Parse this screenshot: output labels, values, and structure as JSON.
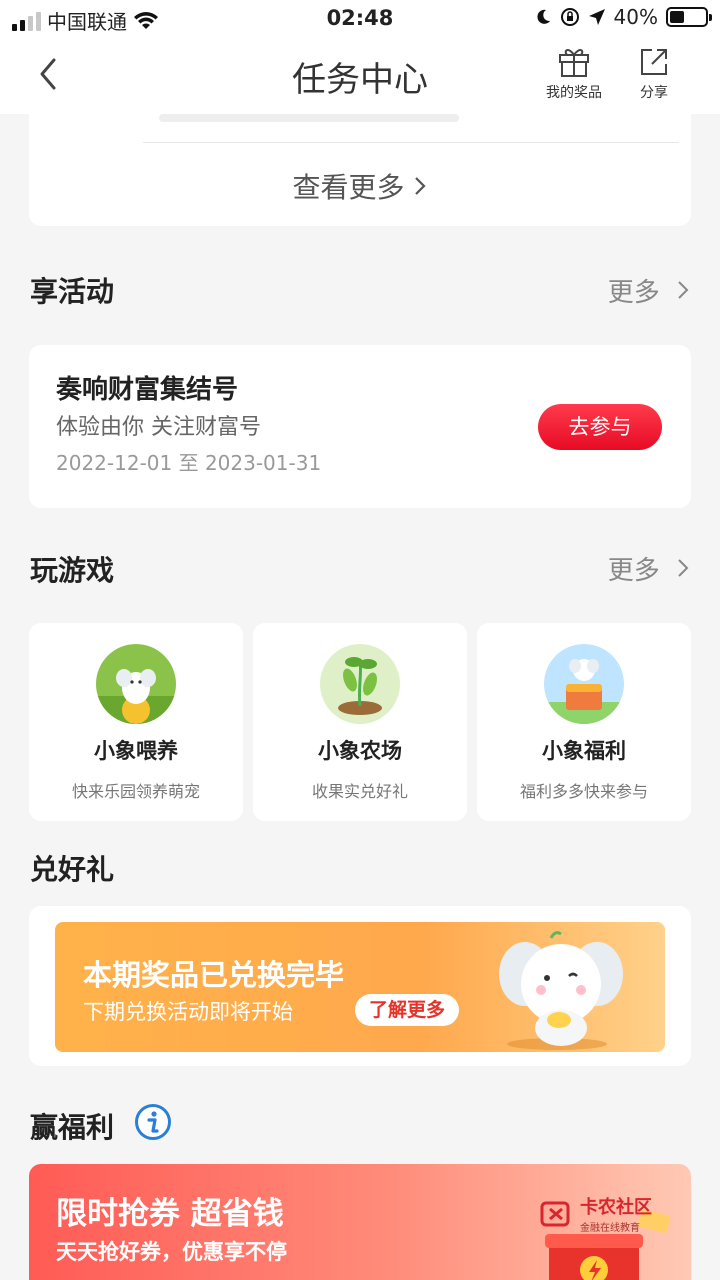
{
  "status_bar": {
    "carrier": "中国联通",
    "time": "02:48",
    "battery": "40%",
    "battery_level": 0.4
  },
  "nav": {
    "title": "任务中心",
    "prizes_label": "我的奖品",
    "share_label": "分享"
  },
  "top_card": {
    "more_label": "查看更多"
  },
  "activities": {
    "title": "享活动",
    "more_label": "更多",
    "item": {
      "name": "奏响财富集结号",
      "desc": "体验由你 关注财富号",
      "date": "2022-12-01 至 2023-01-31",
      "button": "去参与"
    }
  },
  "games": {
    "title": "玩游戏",
    "more_label": "更多",
    "items": [
      {
        "name": "小象喂养",
        "desc": "快来乐园领养萌宠"
      },
      {
        "name": "小象农场",
        "desc": "收果实兑好礼"
      },
      {
        "name": "小象福利",
        "desc": "福利多多快来参与"
      }
    ]
  },
  "gifts": {
    "title": "兑好礼",
    "banner_title": "本期奖品已兑换完毕",
    "banner_sub": "下期兑换活动即将开始",
    "banner_button": "了解更多"
  },
  "welfare": {
    "title": "赢福利",
    "banner_title": "限时抢券 超省钱",
    "banner_sub": "天天抢好券，优惠享不停"
  },
  "watermark": {
    "name": "卡农社区",
    "tagline": "金融在线教育"
  },
  "colors": {
    "accent_red": "#e60b25",
    "banner_orange": "#ffa84c",
    "coupon_red": "#ff5b55"
  }
}
